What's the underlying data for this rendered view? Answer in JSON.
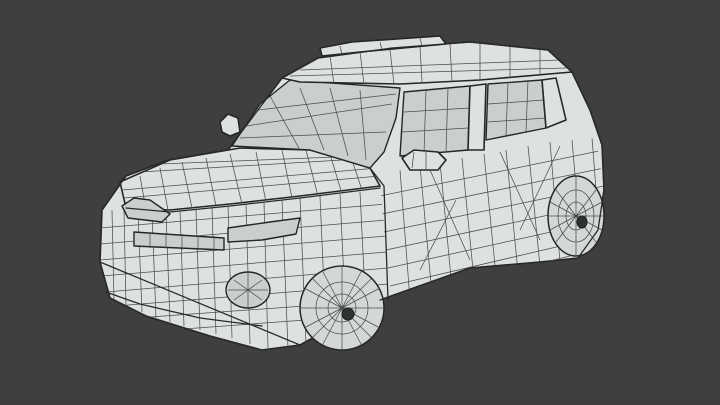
{
  "scene": {
    "background_color": "#3f3f3f",
    "mesh_fill_color": "#dde2e1",
    "wire_color": "#262626",
    "subject": "wireframe-car-mesh",
    "view": "perspective-three-quarter-front-left"
  }
}
